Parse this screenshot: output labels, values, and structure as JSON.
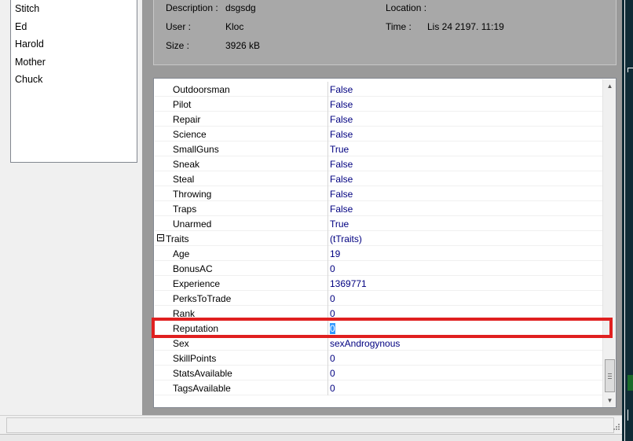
{
  "saves_list": [
    "Stitch",
    "Ed",
    "Harold",
    "Mother",
    "Chuck"
  ],
  "info": {
    "description_label": "Description :",
    "description_value": "dsgsdg",
    "user_label": "User :",
    "user_value": "Kloc",
    "size_label": "Size :",
    "size_value": "3926 kB",
    "location_label": "Location :",
    "location_value": "",
    "time_label": "Time :",
    "time_value": "Lis 24 2197.  11:19"
  },
  "properties": [
    {
      "name": "Outdoorsman",
      "value": "False"
    },
    {
      "name": "Pilot",
      "value": "False"
    },
    {
      "name": "Repair",
      "value": "False"
    },
    {
      "name": "Science",
      "value": "False"
    },
    {
      "name": "SmallGuns",
      "value": "True"
    },
    {
      "name": "Sneak",
      "value": "False"
    },
    {
      "name": "Steal",
      "value": "False"
    },
    {
      "name": "Throwing",
      "value": "False"
    },
    {
      "name": "Traps",
      "value": "False"
    },
    {
      "name": "Unarmed",
      "value": "True"
    },
    {
      "name": "Traits",
      "value": "(tTraits)",
      "category": true
    },
    {
      "name": "Age",
      "value": "19"
    },
    {
      "name": "BonusAC",
      "value": "0"
    },
    {
      "name": "Experience",
      "value": "1369771"
    },
    {
      "name": "PerksToTrade",
      "value": "0"
    },
    {
      "name": "Rank",
      "value": "0"
    },
    {
      "name": "Reputation",
      "value": "0",
      "selected": true
    },
    {
      "name": "Sex",
      "value": "sexAndrogynous"
    },
    {
      "name": "SkillPoints",
      "value": "0"
    },
    {
      "name": "StatsAvailable",
      "value": "0"
    },
    {
      "name": "TagsAvailable",
      "value": "0"
    }
  ],
  "colors": {
    "highlight": "#e02020",
    "value_text": "#000080",
    "selection": "#3399ff"
  },
  "icons": {
    "scroll_up": "▲",
    "scroll_down": "▼",
    "expander": "minus-box-icon"
  }
}
